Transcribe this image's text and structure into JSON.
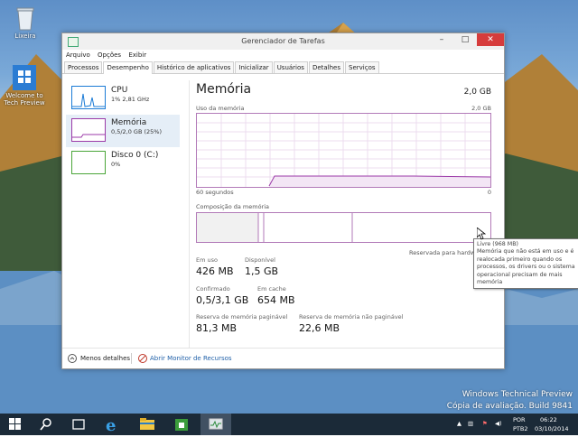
{
  "desktop": {
    "icons": [
      {
        "label": "Lixeira",
        "icon": "recycle-bin-icon"
      },
      {
        "label": "Welcome to Tech Preview",
        "icon": "windows-logo-icon"
      }
    ],
    "watermark_line1": "Windows Technical Preview",
    "watermark_line2": "Cópia de avaliação. Build 9841"
  },
  "window": {
    "title": "Gerenciador de Tarefas",
    "menu": [
      "Arquivo",
      "Opções",
      "Exibir"
    ],
    "tabs": [
      "Processos",
      "Desempenho",
      "Histórico de aplicativos",
      "Inicializar",
      "Usuários",
      "Detalhes",
      "Serviços"
    ],
    "active_tab": "Desempenho",
    "sidebar": [
      {
        "name": "CPU",
        "detail": "1% 2,81 GHz",
        "color": "#1b7bd6"
      },
      {
        "name": "Memória",
        "detail": "0,5/2,0 GB (25%)",
        "color": "#9b3aa8"
      },
      {
        "name": "Disco 0 (C:)",
        "detail": "0%",
        "color": "#4aa638"
      }
    ],
    "main": {
      "title": "Memória",
      "total": "2,0 GB",
      "usage_label": "Uso da memória",
      "usage_max": "2,0 GB",
      "time_left": "60 segundos",
      "time_right": "0",
      "composition_label": "Composição da memória",
      "reserved_label": "Reservada para hardw",
      "stats": {
        "in_use_label": "Em uso",
        "in_use": "426 MB",
        "available_label": "Disponível",
        "available": "1,5 GB",
        "committed_label": "Confirmado",
        "committed": "0,5/3,1 GB",
        "cached_label": "Em cache",
        "cached": "654 MB",
        "paged_label": "Reserva de memória paginável",
        "paged": "81,3 MB",
        "nonpaged_label": "Reserva de memória não paginável",
        "nonpaged": "22,6 MB"
      }
    },
    "tooltip": {
      "line1": "Livre (968 MB)",
      "line2": "Memória que não está em uso e é",
      "line3": "realocada primeiro quando os",
      "line4": "processos, os drivers ou o sistema",
      "line5": "operacional precisam de mais",
      "line6": "memória"
    },
    "footer": {
      "less_details": "Menos detalhes",
      "open_monitor": "Abrir Monitor de Recursos"
    }
  },
  "taskbar": {
    "lang1": "POR",
    "lang2": "PTB2",
    "time": "06:22",
    "date": "03/10/2014"
  },
  "colors": {
    "accent": "#9b3aa8",
    "taskbar": "#1b2a38",
    "close": "#d63c3c"
  }
}
